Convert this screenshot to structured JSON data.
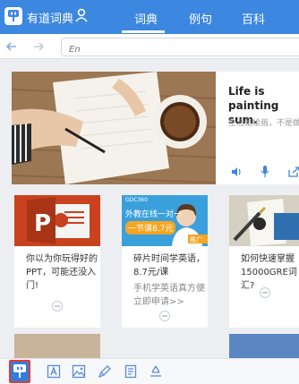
{
  "app": {
    "title": "有道词典"
  },
  "tabs": [
    {
      "label": "词典",
      "active": true
    },
    {
      "label": "例句",
      "active": false
    },
    {
      "label": "百科",
      "active": false
    }
  ],
  "nav": {
    "back_icon": "arrow-left-icon",
    "forward_icon": "arrow-right-icon",
    "url_placeholder": "En"
  },
  "hero": {
    "title": "Life is painting sum.",
    "subtitle": "生活是绘画，不是做",
    "image": "photo of a hand writing in a notebook beside a coffee cup"
  },
  "cards": [
    {
      "title": "你以为你玩得好的PPT，可能还没入门!",
      "image": "PowerPoint logo",
      "icon": "e-logo-icon"
    },
    {
      "title": "碎片时间学英语，8.7元/课",
      "subtitle": "手机学英语真方便立即申请>>",
      "ad_banner": {
        "header": "GDC360",
        "line1": "外教在线一对一",
        "price": "一节课8.7元",
        "tag": "推广"
      },
      "icon": "e-logo-icon"
    },
    {
      "title": "如何快速掌握15000GRE词汇?",
      "image": "fountain pen and GRE book",
      "icon": "e-logo-icon"
    }
  ],
  "bottom_nav": [
    {
      "icon": "youdao-logo-icon",
      "active": true
    },
    {
      "icon": "translate-a-icon",
      "active": false
    },
    {
      "icon": "image-translate-icon",
      "active": false
    },
    {
      "icon": "pen-icon",
      "active": false
    },
    {
      "icon": "notebook-icon",
      "active": false
    },
    {
      "icon": "recycle-icon",
      "active": false
    }
  ],
  "colors": {
    "accent": "#3c87e0",
    "active_outline": "#e53935",
    "background": "#eceef2"
  }
}
